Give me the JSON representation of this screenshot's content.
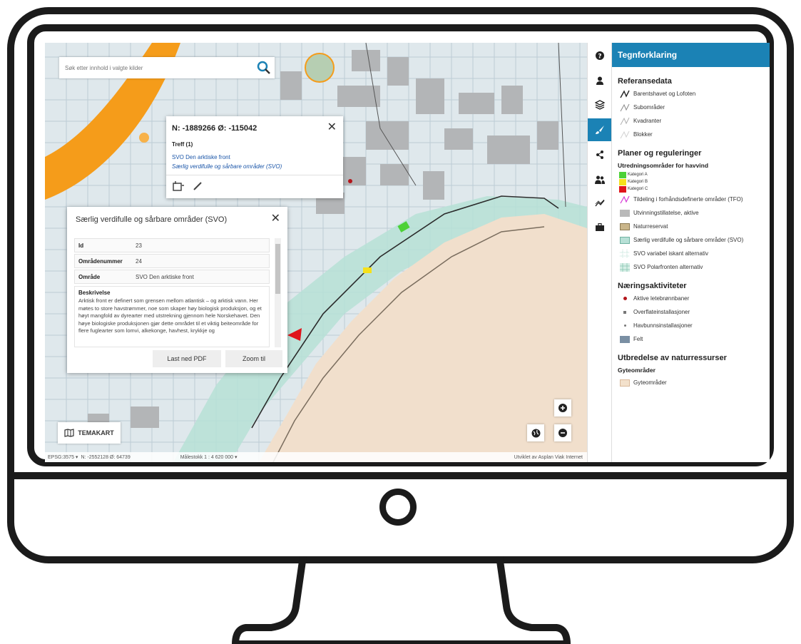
{
  "search": {
    "placeholder": "Søk etter innhold i valgte kilder"
  },
  "popup": {
    "coords": "N: -1889266 Ø: -115042",
    "close": "✕",
    "hits": "Treff (1)",
    "result_name": "SVO Den arktiske front",
    "result_type": "Særlig verdifulle og sårbare områder (SVO)"
  },
  "info_panel": {
    "title": "Særlig verdifulle og sårbare områder (SVO)",
    "close": "✕",
    "rows": [
      {
        "key": "Id",
        "value": "23"
      },
      {
        "key": "Områdenummer",
        "value": "24"
      },
      {
        "key": "Område",
        "value": "SVO Den arktiske front"
      }
    ],
    "description_label": "Beskrivelse",
    "description": "Arktisk front er definert som grensen mellom atlantisk – og arktisk vann. Her møtes to store havstrømmer, noe som skaper høy biologisk produksjon, og et høyt mangfold av dyrearter med utstrekning gjennom hele Norskehavet. Den høye biologiske produksjonen gjør dette området til et viktig beiteområde for flere fuglearter som lomvi, alkekonge, havhest, krykkje og",
    "download_button": "Last ned PDF",
    "zoom_button": "Zoom til"
  },
  "map": {
    "theme_button": "TEMAKART",
    "status_projection": "EPSG:3575 ▾",
    "status_coords": "N: -2552128 Ø: 64739",
    "status_scale": "Målestokk 1 : 4 620 000 ▾",
    "status_credit": "Utviklet av Asplan Viak Internet"
  },
  "legend": {
    "title": "Tegnforklaring",
    "reference_title": "Referansedata",
    "reference_items": [
      "Barentshavet og Lofoten",
      "Subområder",
      "Kvadranter",
      "Blokker"
    ],
    "planning_title": "Planer og reguleringer",
    "wind_subtitle": "Utredningsområder for havvind",
    "wind_categories": [
      "Kategori A",
      "Kategori B",
      "Kategori C"
    ],
    "planning_items": [
      "Tildeling i forhåndsdefinerte områder (TFO)",
      "Utvinningstillatelse, aktive",
      "Naturreservat",
      "Særlig verdifulle og sårbare områder (SVO)",
      "SVO variabel iskant alternativ",
      "SVO Polarfronten alternativ"
    ],
    "industry_title": "Næringsaktiviteter",
    "industry_items": [
      "Aktive letebrønnbaner",
      "Overflateinstallasjoner",
      "Havbunnsinstallasjoner",
      "Felt"
    ],
    "resources_title": "Utbredelse av naturressurser",
    "spawning_subtitle": "Gyteområder",
    "spawning_item": "Gyteområder"
  },
  "colors": {
    "accent": "#1b82b5",
    "category_a": "#4cd137",
    "category_b": "#f5e11b",
    "category_c": "#e0141b",
    "land": "#f1dfcc",
    "svo": "#b7e0d6",
    "licence": "#b9b9b9",
    "gulf": "#f59c1a"
  }
}
